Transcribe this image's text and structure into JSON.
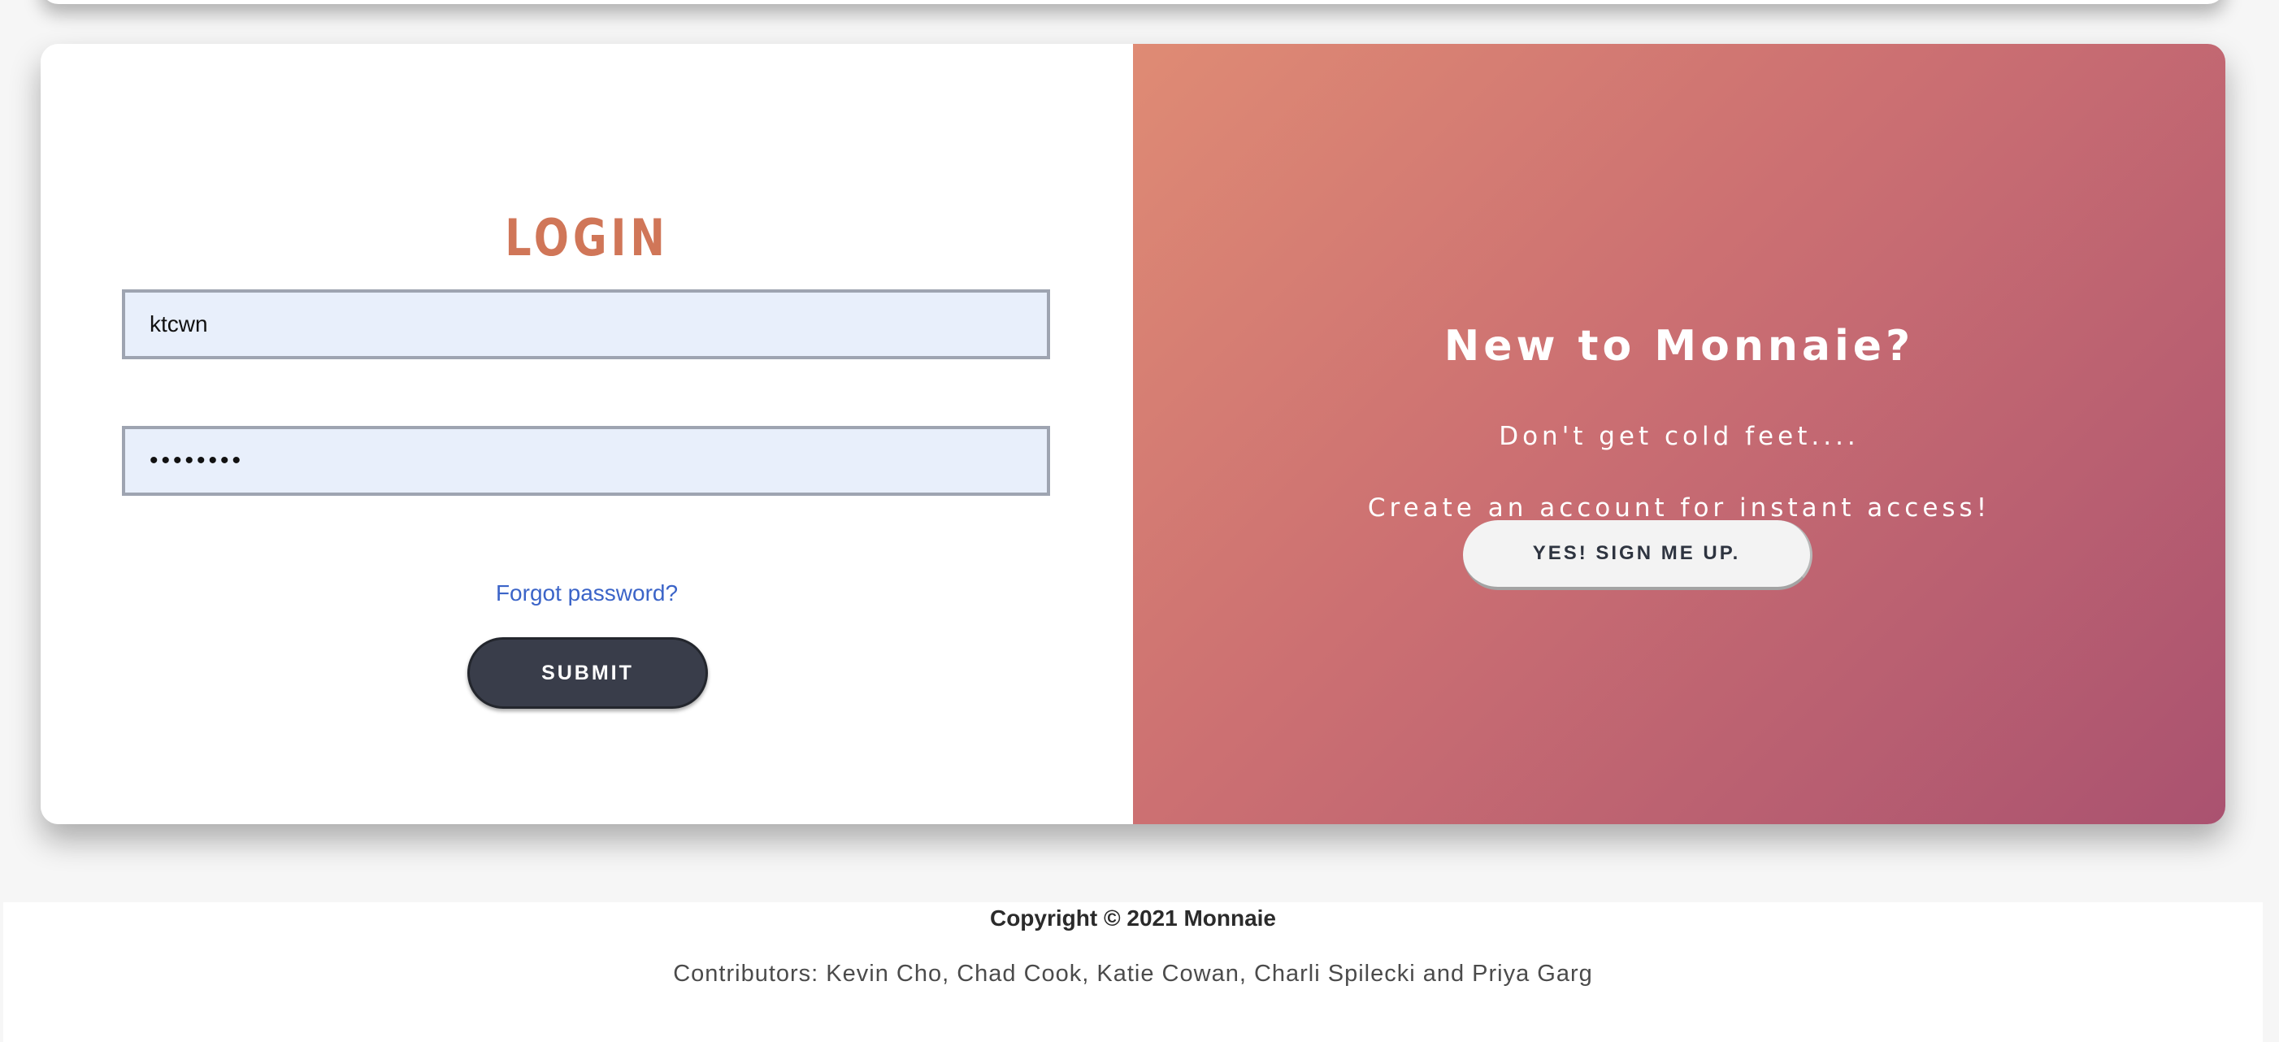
{
  "login": {
    "title": "LOGIN",
    "username_value": "ktcwn",
    "password_value": "••••••••",
    "forgot_password_label": "Forgot password?",
    "submit_label": "SUBMIT"
  },
  "signup": {
    "title": "New to Monnaie?",
    "line1": "Don't get cold feet....",
    "line2": "Create an account for instant access!",
    "button_label": "YES! SIGN ME UP."
  },
  "footer": {
    "copyright": "Copyright © 2021 Monnaie",
    "contributors": "Contributors: Kevin Cho, Chad Cook, Katie Cowan, Charli Spilecki and Priya Garg"
  },
  "colors": {
    "login_title": "#d07658",
    "field_background": "#e8effb",
    "link": "#3b64c8",
    "submit_button": "#393d4a",
    "gradient_start": "#df8b74",
    "gradient_end": "#aa5270"
  }
}
